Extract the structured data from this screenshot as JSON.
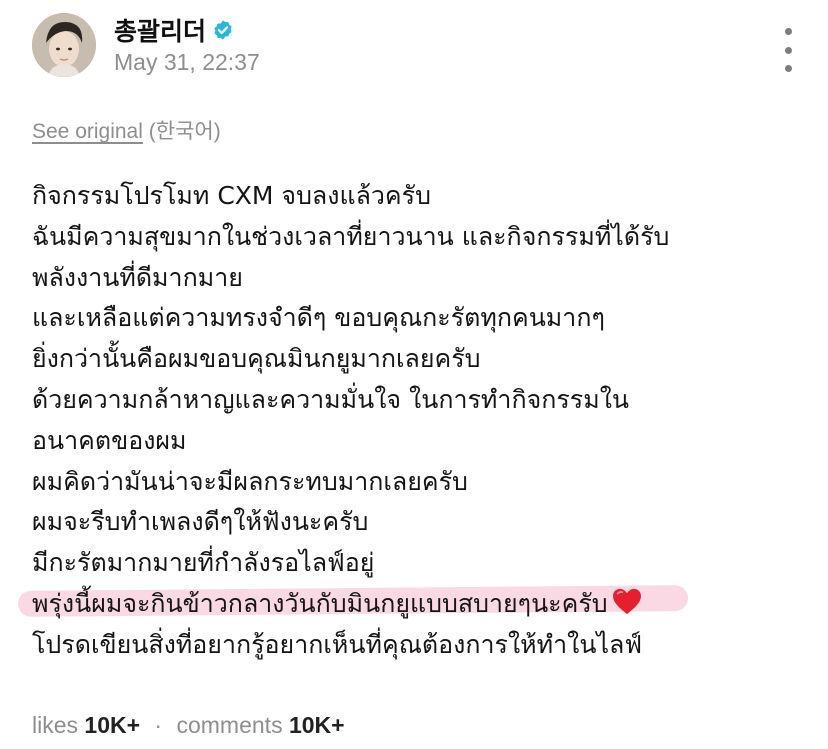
{
  "post": {
    "author": "총괄리더",
    "timestamp": "May 31, 22:37",
    "see_original": "See original",
    "original_language": "(한국어)",
    "lines": [
      "กิจกรรมโปรโมท CXM จบลงแล้วครับ",
      "ฉันมีความสุขมากในช่วงเวลาที่ยาวนาน และกิจกรรมที่ได้รับ",
      "พลังงานที่ดีมากมาย",
      "และเหลือแต่ความทรงจำดีๆ ขอบคุณกะรัตทุกคนมากๆ",
      "ยิ่งกว่านั้นคือผมขอบคุณมินกยูมากเลยครับ",
      "ด้วยความกล้าหาญและความมั่นใจ ในการทำกิจกรรมใน",
      "อนาคตของผม",
      "ผมคิดว่ามันน่าจะมีผลกระทบมากเลยครับ",
      "ผมจะรีบทำเพลงดีๆให้ฟังนะครับ",
      "มีกะรัตมากมายที่กำลังรอไลฟ์อยู่",
      "พรุ่งนี้ผมจะกินข้าวกลางวันกับมินกยูแบบสบายๆนะครับ",
      "โปรดเขียนสิ่งที่อยากรู้อยากเห็นที่คุณต้องการให้ทำในไลฟ์"
    ],
    "highlighted_line_index": 10,
    "highlight_color": "#f5b9cd",
    "heart_icon": "red-heart-emoji",
    "verified_icon": "verified-badge-icon",
    "verified_color": "#2bb7d9"
  },
  "footer": {
    "likes_label": "likes",
    "likes_count": "10K+",
    "separator": "·",
    "comments_label": "comments",
    "comments_count": "10K+"
  }
}
